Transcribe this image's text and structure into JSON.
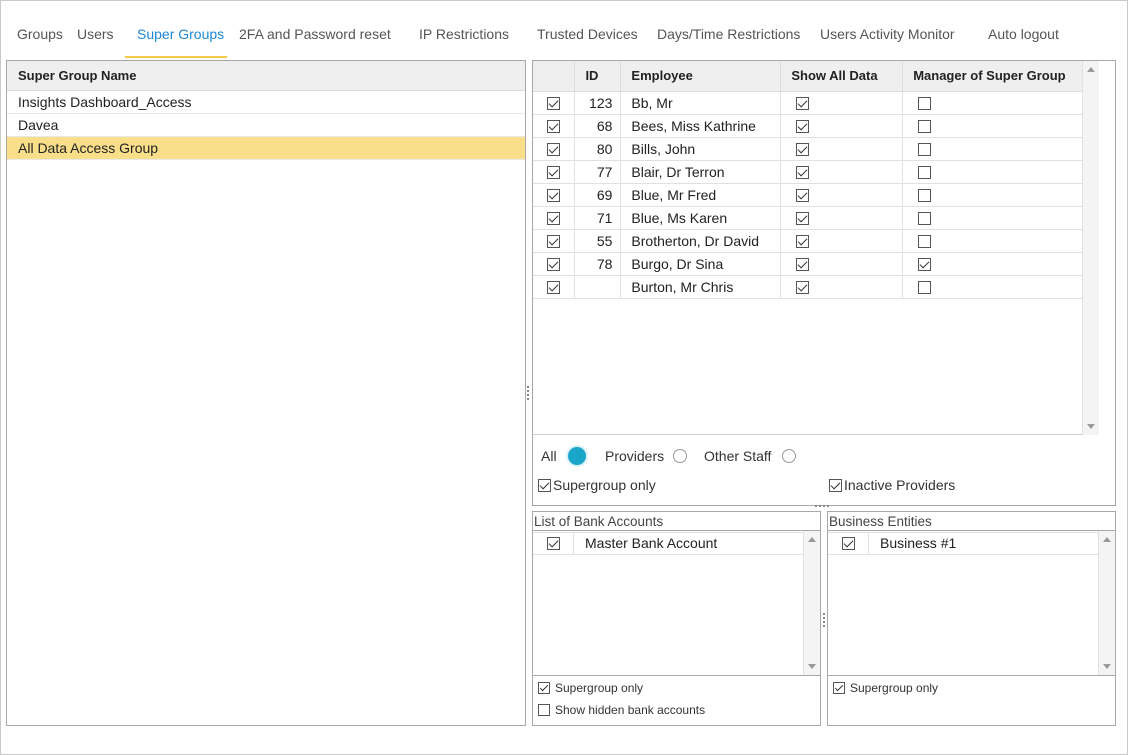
{
  "tabs": [
    {
      "label": "Groups",
      "active": false
    },
    {
      "label": "Users",
      "active": false
    },
    {
      "label": "Super Groups",
      "active": true
    },
    {
      "label": "2FA and Password reset",
      "active": false
    },
    {
      "label": "IP Restrictions",
      "active": false
    },
    {
      "label": "Trusted Devices",
      "active": false
    },
    {
      "label": "Days/Time Restrictions",
      "active": false
    },
    {
      "label": "Users Activity Monitor",
      "active": false
    },
    {
      "label": "Auto logout",
      "active": false
    }
  ],
  "super_groups": {
    "header": "Super Group Name",
    "rows": [
      {
        "name": "Insights Dashboard_Access",
        "selected": false
      },
      {
        "name": "Davea",
        "selected": false
      },
      {
        "name": "All Data Access Group",
        "selected": true
      }
    ]
  },
  "employees": {
    "columns": {
      "check": "",
      "id": "ID",
      "employee": "Employee",
      "show_all": "Show All Data",
      "manager": "Manager of Super Group"
    },
    "rows": [
      {
        "checked": true,
        "id": "123",
        "name": "Bb, Mr",
        "show_all": true,
        "manager": false
      },
      {
        "checked": true,
        "id": "68",
        "name": "Bees, Miss Kathrine",
        "show_all": true,
        "manager": false
      },
      {
        "checked": true,
        "id": "80",
        "name": "Bills, John",
        "show_all": true,
        "manager": false
      },
      {
        "checked": true,
        "id": "77",
        "name": "Blair, Dr Terron",
        "show_all": true,
        "manager": false
      },
      {
        "checked": true,
        "id": "69",
        "name": "Blue, Mr Fred",
        "show_all": true,
        "manager": false
      },
      {
        "checked": true,
        "id": "71",
        "name": "Blue, Ms Karen",
        "show_all": true,
        "manager": false
      },
      {
        "checked": true,
        "id": "55",
        "name": "Brotherton, Dr David",
        "show_all": true,
        "manager": false
      },
      {
        "checked": true,
        "id": "78",
        "name": "Burgo, Dr Sina",
        "show_all": true,
        "manager": true
      },
      {
        "checked": true,
        "id": "",
        "name": "Burton, Mr Chris",
        "show_all": true,
        "manager": false
      }
    ]
  },
  "filters": {
    "all_label": "All",
    "providers_label": "Providers",
    "other_staff_label": "Other Staff",
    "selected": "All",
    "supergroup_only_label": "Supergroup only",
    "supergroup_only": true,
    "inactive_providers_label": "Inactive Providers",
    "inactive_providers": true
  },
  "bank_accounts": {
    "title": "List of Bank Accounts",
    "rows": [
      {
        "checked": true,
        "name": "Master Bank Account"
      }
    ],
    "supergroup_only_label": "Supergroup only",
    "supergroup_only": true,
    "show_hidden_label": "Show hidden bank accounts",
    "show_hidden": false
  },
  "business_entities": {
    "title": "Business Entities",
    "rows": [
      {
        "checked": true,
        "name": "Business #1"
      }
    ],
    "supergroup_only_label": "Supergroup only",
    "supergroup_only": true
  },
  "colors": {
    "accent": "#1e88d6",
    "tab_underline": "#f2c94c",
    "selected_row": "#f9df8a",
    "radio_selected": "#19a6c9"
  }
}
